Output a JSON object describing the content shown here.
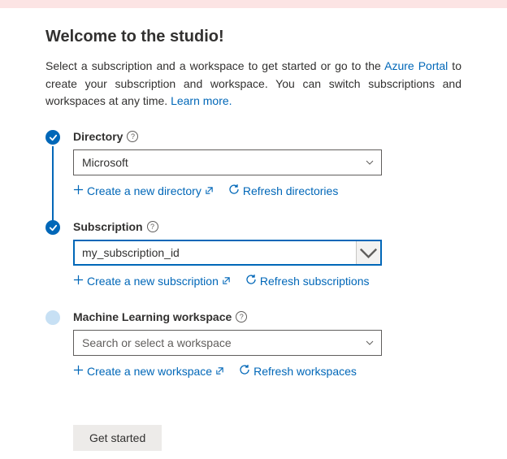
{
  "title": "Welcome to the studio!",
  "intro": {
    "part1": "Select a subscription and a workspace to get started or go to the ",
    "azure_link": "Azure Portal",
    "part2": " to create your subscription and workspace. You can switch subscriptions and workspaces at any time. ",
    "learn_link": "Learn more."
  },
  "steps": {
    "directory": {
      "label": "Directory",
      "value": "Microsoft",
      "create": "Create a new directory",
      "refresh": "Refresh directories"
    },
    "subscription": {
      "label": "Subscription",
      "value": "my_subscription_id",
      "create": "Create a new subscription",
      "refresh": "Refresh subscriptions"
    },
    "workspace": {
      "label": "Machine Learning workspace",
      "placeholder": "Search or select a workspace",
      "create": "Create a new workspace",
      "refresh": "Refresh workspaces"
    }
  },
  "button": "Get started"
}
